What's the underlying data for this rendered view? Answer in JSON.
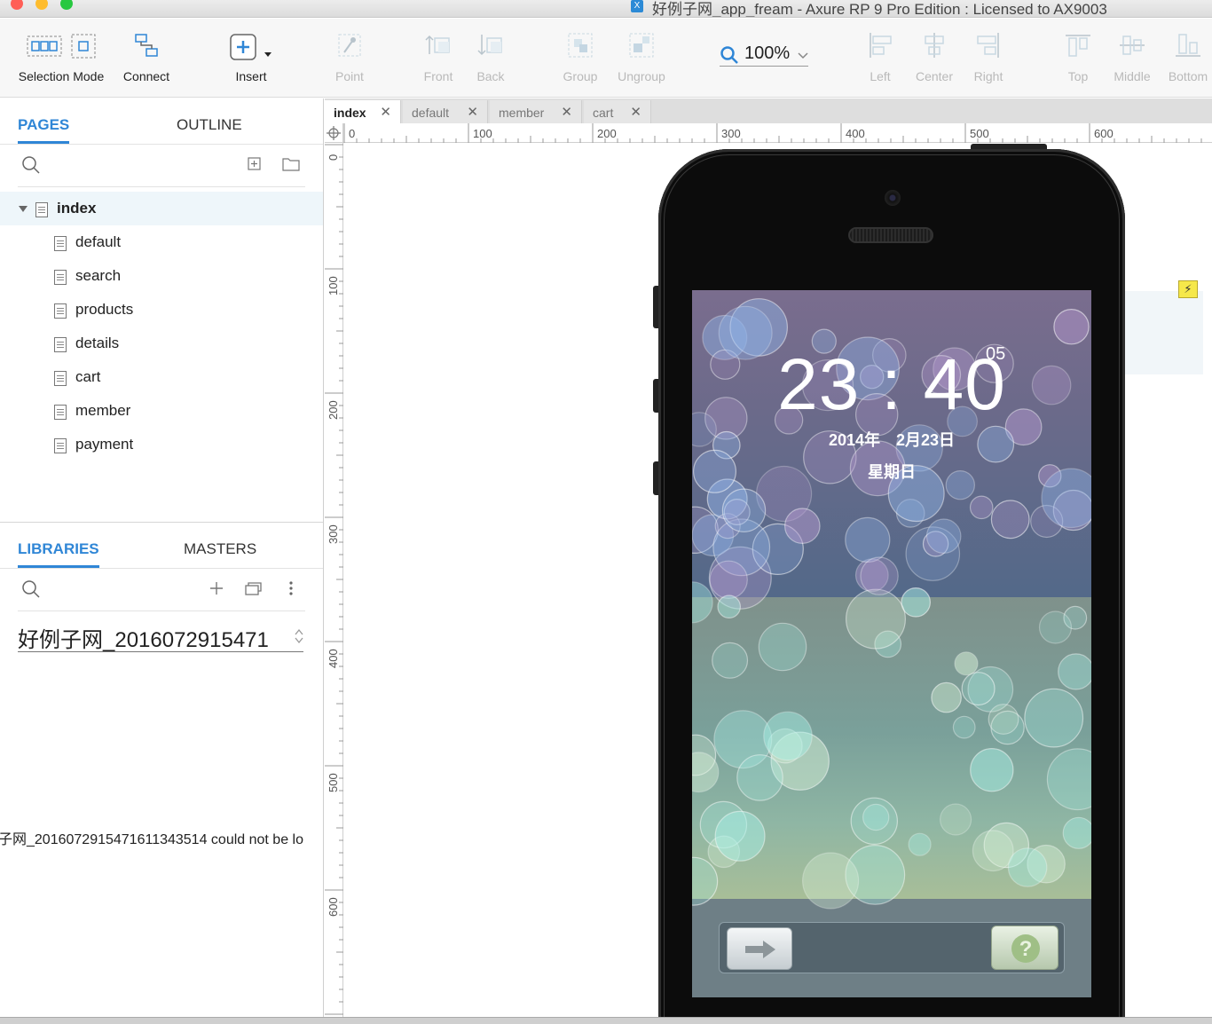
{
  "window": {
    "title": "好例子网_app_fream - Axure RP 9 Pro Edition : Licensed to AX9003",
    "app_icon_glyph": "X"
  },
  "toolbar": {
    "selection_mode": "Selection Mode",
    "connect": "Connect",
    "insert": "Insert",
    "point": "Point",
    "front": "Front",
    "back": "Back",
    "group": "Group",
    "ungroup": "Ungroup",
    "zoom": "100%",
    "left": "Left",
    "center": "Center",
    "right": "Right",
    "top": "Top",
    "middle": "Middle",
    "bottom": "Bottom"
  },
  "pages_panel": {
    "tabs": [
      "PAGES",
      "OUTLINE"
    ],
    "active_tab": "PAGES",
    "root": "index",
    "children": [
      "default",
      "search",
      "products",
      "details",
      "cart",
      "member",
      "payment"
    ]
  },
  "libraries_panel": {
    "tabs": [
      "LIBRARIES",
      "MASTERS"
    ],
    "active_tab": "LIBRARIES",
    "selected_library": "好例子网_2016072915471",
    "error_message": "子网_20160729154716113435​14 could not be lo"
  },
  "doc_tabs": [
    {
      "label": "index",
      "active": true
    },
    {
      "label": "default",
      "active": false
    },
    {
      "label": "member",
      "active": false
    },
    {
      "label": "cart",
      "active": false
    }
  ],
  "rulers": {
    "horizontal": [
      "0",
      "100",
      "200",
      "300",
      "400",
      "500",
      "600"
    ],
    "vertical": [
      "0",
      "100",
      "200",
      "300",
      "400",
      "500",
      "600"
    ]
  },
  "lockscreen": {
    "time": "23 : 40",
    "seconds": "05",
    "date": "2014年　2月23日",
    "weekday": "星期日"
  },
  "colors": {
    "accent": "#2f86d6",
    "selected_row": "#eef6fa",
    "interaction_badge": "#f6e84a"
  },
  "icons": {
    "search": "search-icon",
    "add_page": "add-page-icon",
    "add_folder": "add-folder-icon",
    "add_library": "plus-icon",
    "library_options": "stack-icon",
    "more": "more-vertical-icon",
    "interaction": "lightning-icon"
  }
}
